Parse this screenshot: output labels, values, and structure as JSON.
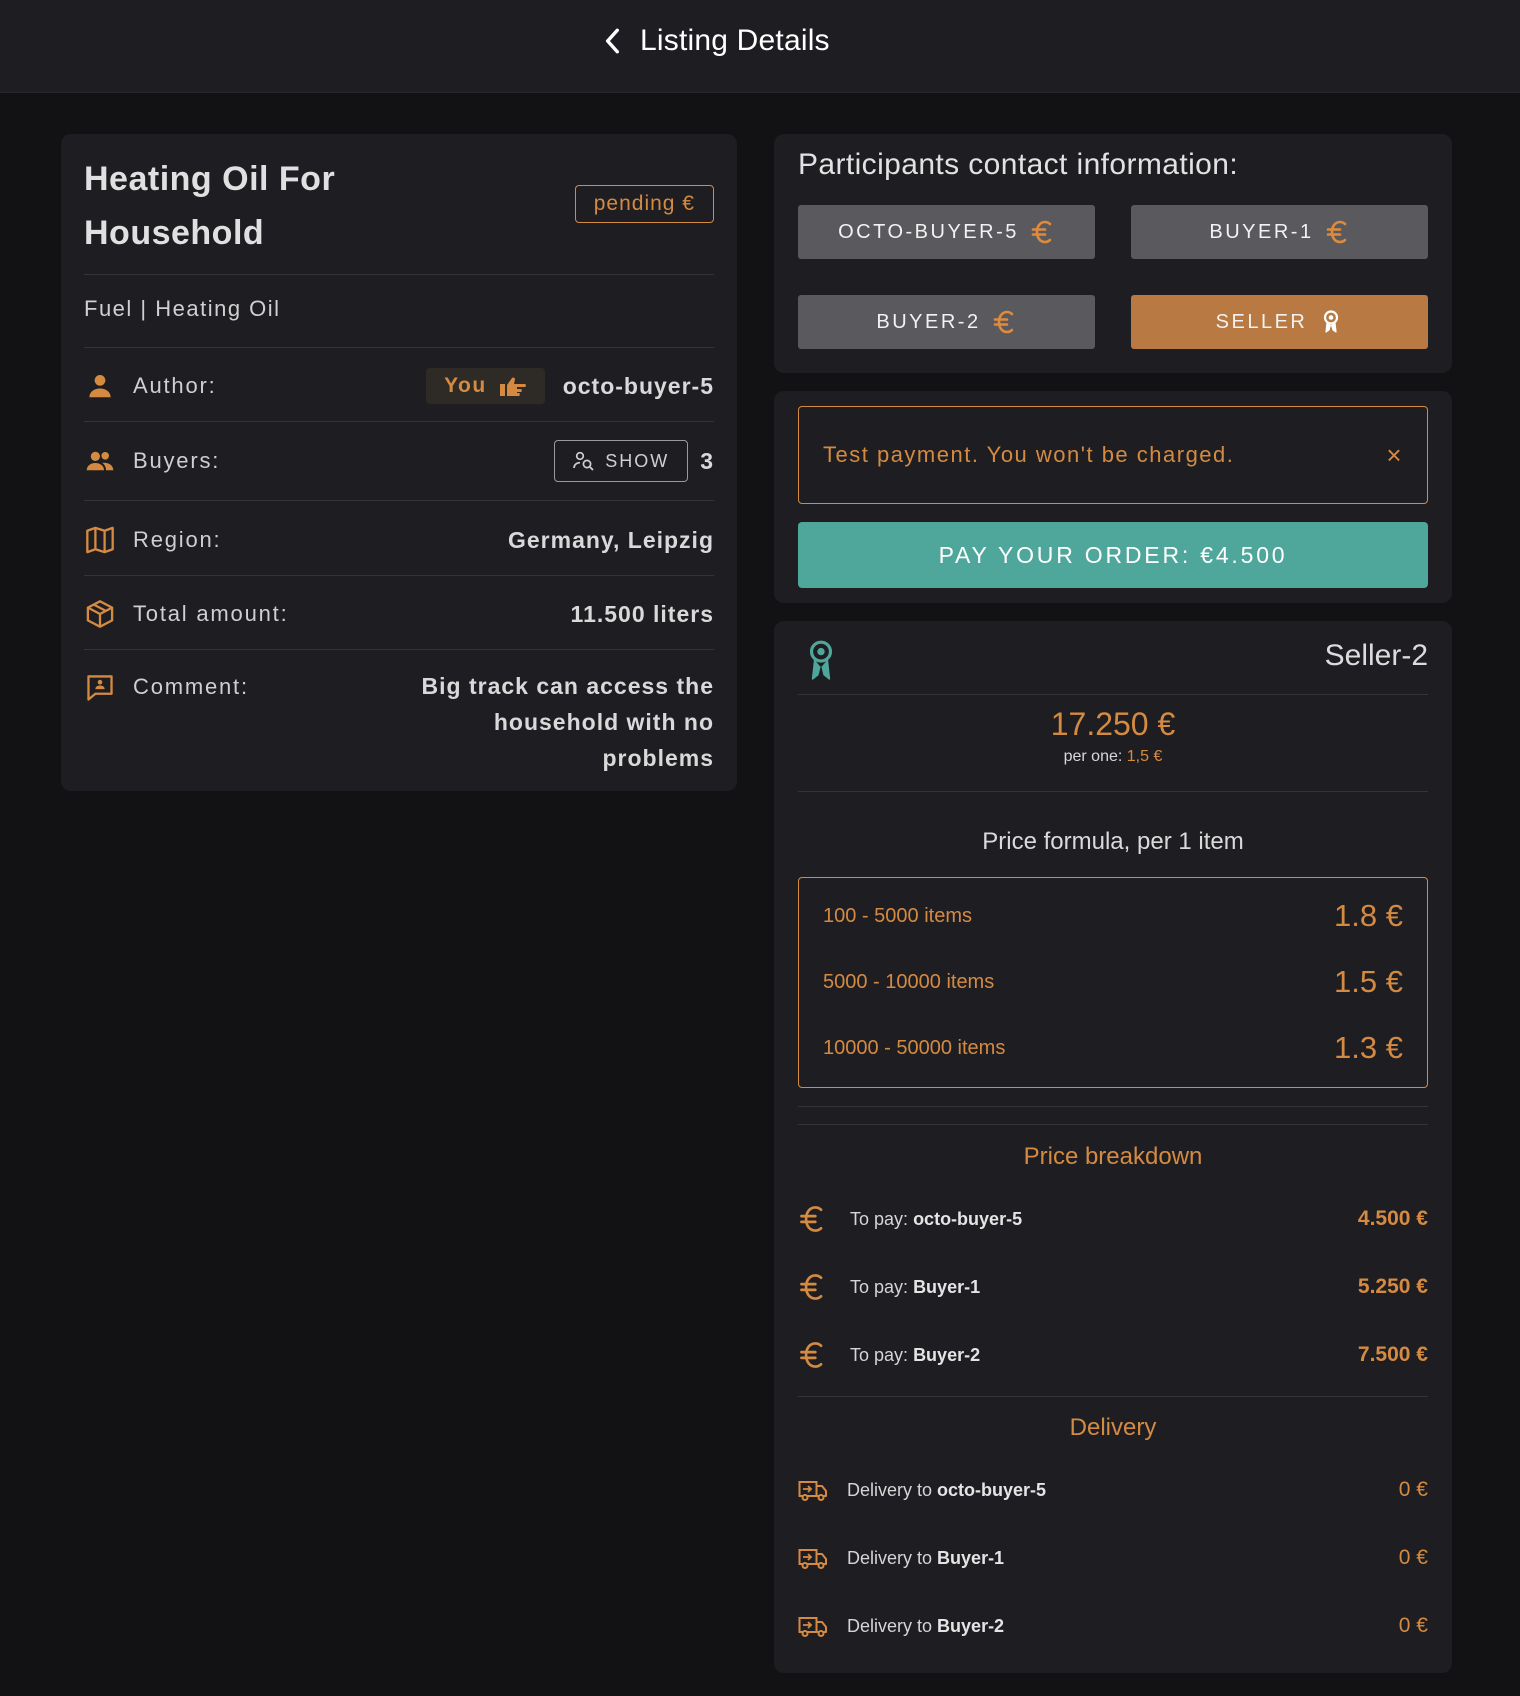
{
  "header": {
    "title": "Listing Details",
    "back_icon": "chevron-left-icon"
  },
  "listing": {
    "title_line1": "Heating Oil For",
    "title_line2": "Household",
    "status": "pending €",
    "category": "Fuel | Heating Oil",
    "author_label": "Author:",
    "you_chip": "You",
    "author_value": "octo-buyer-5",
    "buyers_label": "Buyers:",
    "show_label": "SHOW",
    "buyers_count": "3",
    "region_label": "Region:",
    "region_value": "Germany, Leipzig",
    "amount_label": "Total amount:",
    "amount_value": "11.500 liters",
    "comment_label": "Comment:",
    "comment_line1": "Big track can access the",
    "comment_line2": "household with no",
    "comment_line3": "problems"
  },
  "contacts": {
    "title": "Participants contact information:",
    "buttons": [
      {
        "label": "OCTO-BUYER-5",
        "icon": "euro-icon"
      },
      {
        "label": "BUYER-1",
        "icon": "euro-icon"
      },
      {
        "label": "BUYER-2",
        "icon": "euro-icon"
      },
      {
        "label": "SELLER",
        "icon": "award-icon"
      }
    ]
  },
  "payment": {
    "alert": "Test payment. You won't be charged.",
    "close": "×",
    "pay_button": "PAY YOUR ORDER: €4.500"
  },
  "offer": {
    "seller_name": "Seller-2",
    "total_price": "17.250 €",
    "per_one_label": "per one:",
    "per_one_value": "1,5 €",
    "formula_title": "Price formula, per 1 item",
    "formula": [
      {
        "range": "100 - 5000 items",
        "price": "1.8 €"
      },
      {
        "range": "5000 - 10000 items",
        "price": "1.5 €"
      },
      {
        "range": "10000 - 50000 items",
        "price": "1.3 €"
      }
    ],
    "breakdown_title": "Price breakdown",
    "breakdown": [
      {
        "prefix": "To pay:",
        "name": "octo-buyer-5",
        "amount": "4.500 €"
      },
      {
        "prefix": "To pay:",
        "name": "Buyer-1",
        "amount": "5.250 €"
      },
      {
        "prefix": "To pay:",
        "name": "Buyer-2",
        "amount": "7.500 €"
      }
    ],
    "delivery_title": "Delivery",
    "delivery": [
      {
        "prefix": "Delivery to",
        "name": "octo-buyer-5",
        "amount": "0 €"
      },
      {
        "prefix": "Delivery to",
        "name": "Buyer-1",
        "amount": "0 €"
      },
      {
        "prefix": "Delivery to",
        "name": "Buyer-2",
        "amount": "0 €"
      }
    ]
  },
  "colors": {
    "accent": "#d58a42",
    "pay": "#4fa79c",
    "background": "#121214",
    "card": "#1e1e22"
  }
}
